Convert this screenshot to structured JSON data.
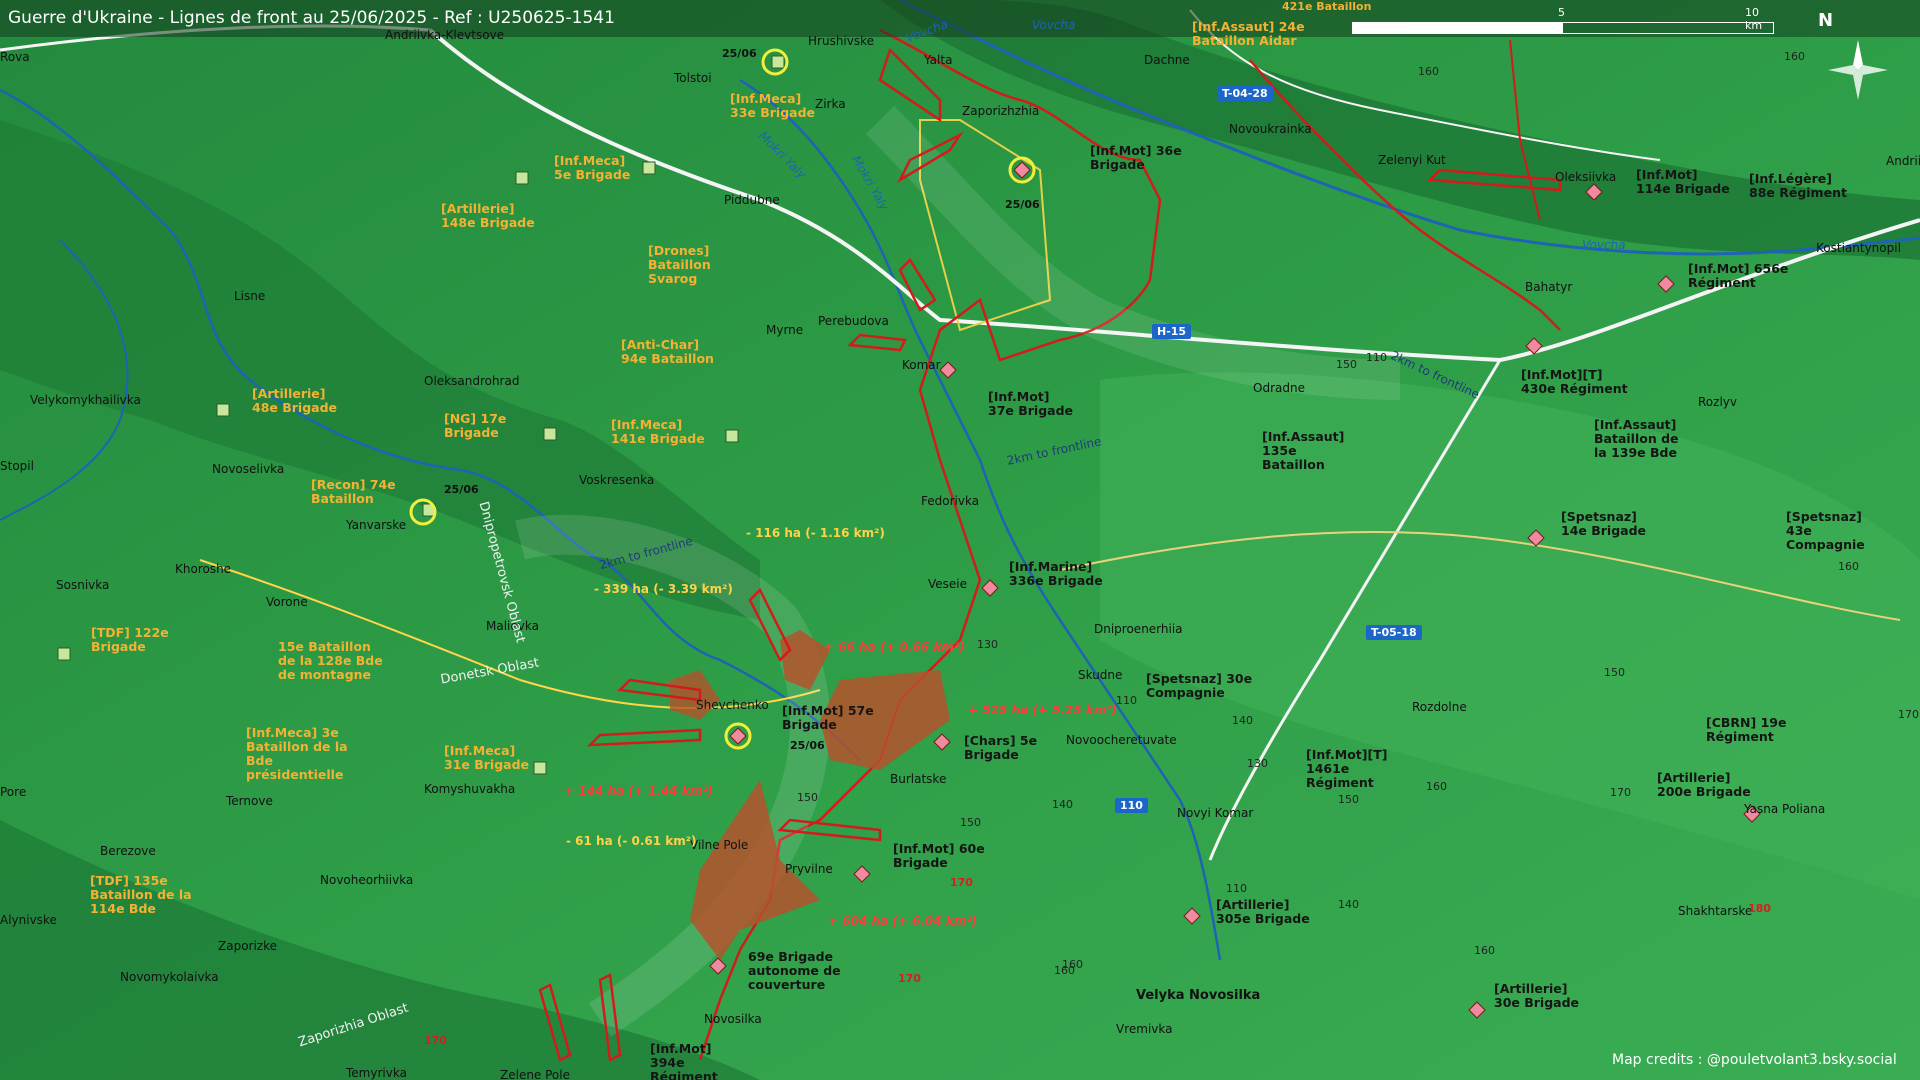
{
  "title": "Guerre d'Ukraine - Lignes de front au 25/06/2025 - Ref : U250625-1541",
  "scale": {
    "mid": "5",
    "end": "10 km"
  },
  "north": "N",
  "credits": "Map credits : @pouletvolant3.bsky.social",
  "roads": [
    "T-04-28",
    "H-15",
    "T-05-18",
    "110"
  ],
  "places": [
    "Andriivka-Klevtsove",
    "Tolstoi",
    "Hrushivske",
    "Yalta",
    "Dachne",
    "Zirka",
    "Zaporizhzhia",
    "Novoukrainka",
    "Zelenyi Kut",
    "Oleksiivka",
    "Piddubne",
    "Lisne",
    "Myrne",
    "Perebudova",
    "Komar",
    "Bahatyr",
    "Kostiantynopil",
    "Odradne",
    "Rozlyv",
    "Velykomykhailivka",
    "Oleksandrohrad",
    "Novoselivka",
    "Voskresenka",
    "Yanvarske",
    "Fedorivka",
    "Khoroshe",
    "Sosnivka",
    "Vorone",
    "Veseie",
    "Malievka",
    "Dniproenerhiia",
    "Skudne",
    "Shevchenko",
    "Burlatske",
    "Novoocheretuvate",
    "Rozdolne",
    "Komyshuvakha",
    "Ternove",
    "Vilne Pole",
    "Pryvilne",
    "Novyi Komar",
    "Berezove",
    "Novoheorhiivka",
    "Zaporizke",
    "Novomykolaivka",
    "Shakhtarske",
    "Yasna Poliana",
    "Velyka Novosilka",
    "Vremivka",
    "Novosilka",
    "Temyrivka",
    "Zelene Pole",
    "Stopil",
    "Alynivske",
    "Andrii",
    "Rova",
    "Pore"
  ],
  "rivers": [
    "Vovcha",
    "Mokri Yaly",
    "Mokri Yaly",
    "Vovcha",
    "Vovcha"
  ],
  "oblasts": [
    "Dnipropetrovsk Oblast",
    "Donetsk Oblast",
    "Zaporizhia Oblast"
  ],
  "frontline_notes": [
    "2km to frontline",
    "2km to frontline",
    "2km to frontline"
  ],
  "dates": [
    "25/06",
    "25/06",
    "25/06",
    "25/06"
  ],
  "altitudes": [
    "160",
    "160",
    "130",
    "110",
    "150",
    "150",
    "160",
    "170",
    "130",
    "140",
    "150",
    "160",
    "170",
    "150",
    "140",
    "110",
    "170",
    "160",
    "180",
    "170",
    "140",
    "160",
    "150",
    "170",
    "160",
    "110"
  ],
  "russian_units": [
    "[Inf.Assaut] 24e Bataillon Aidar",
    "[Inf.Meca] 33e Brigade",
    "[Inf.Meca] 5e Brigade",
    "[Artillerie] 148e Brigade",
    "[Drones] Bataillon Svarog",
    "[Anti-Char] 94e Bataillon",
    "[Artillerie] 48e Brigade",
    "[NG] 17e Brigade",
    "[Inf.Meca] 141e Brigade",
    "[Recon] 74e Bataillon",
    "[TDF] 122e Brigade",
    "15e Bataillon de la 128e Bde de montagne",
    "[Inf.Meca] 3e Bataillon de la Bde présidentielle",
    "[Inf.Meca] 31e Brigade",
    "[TDF] 135e Bataillon de la 114e Bde",
    "421e Bataillon"
  ],
  "ukrainian_units": [
    "[Inf.Mot] 36e Brigade",
    "[Inf.Mot] 114e Brigade",
    "[Inf.Légère] 88e Régiment",
    "[Inf.Mot] 656e Régiment",
    "[Inf.Mot] 37e Brigade",
    "[Inf.Mot][T] 430e Régiment",
    "[Inf.Assaut] 135e Bataillon",
    "[Inf.Assaut] Bataillon de la 139e Bde",
    "[Spetsnaz] 14e Brigade",
    "[Spetsnaz] 43e Compagnie",
    "[Inf.Marine] 336e Brigade",
    "[Spetsnaz] 30e Compagnie",
    "[Inf.Mot] 57e Brigade",
    "[Chars] 5e Brigade",
    "[Inf.Mot][T] 1461e Régiment",
    "[CBRN] 19e Régiment",
    "[Artillerie] 200e Brigade",
    "[Inf.Mot] 60e Brigade",
    "[Artillerie] 305e Brigade",
    "69e Brigade autonome de couverture",
    "[Artillerie] 30e Brigade",
    "[Inf.Mot] 394e Régiment"
  ],
  "area_changes": {
    "red": [
      "+ 66 ha (+ 0.66 km²)",
      "+ 525 ha (+ 5.25 km²)",
      "+ 144 ha (+ 1.44 km²)",
      "+ 604 ha (+ 6.04 km²)"
    ],
    "gold": [
      "- 116 ha (- 1.16 km²)",
      "- 339 ha (- 3.39 km²)",
      "- 61 ha (- 0.61 km²)"
    ]
  },
  "colors": {
    "ukraine_unit": "#151515",
    "russia_unit": "#f3b233",
    "front_red": "#d21c1c",
    "gain_fill": "#b5522b",
    "terrain_dark": "#1f7f3a",
    "terrain_light": "#44b05a",
    "road_badge": "#1d66c9"
  }
}
